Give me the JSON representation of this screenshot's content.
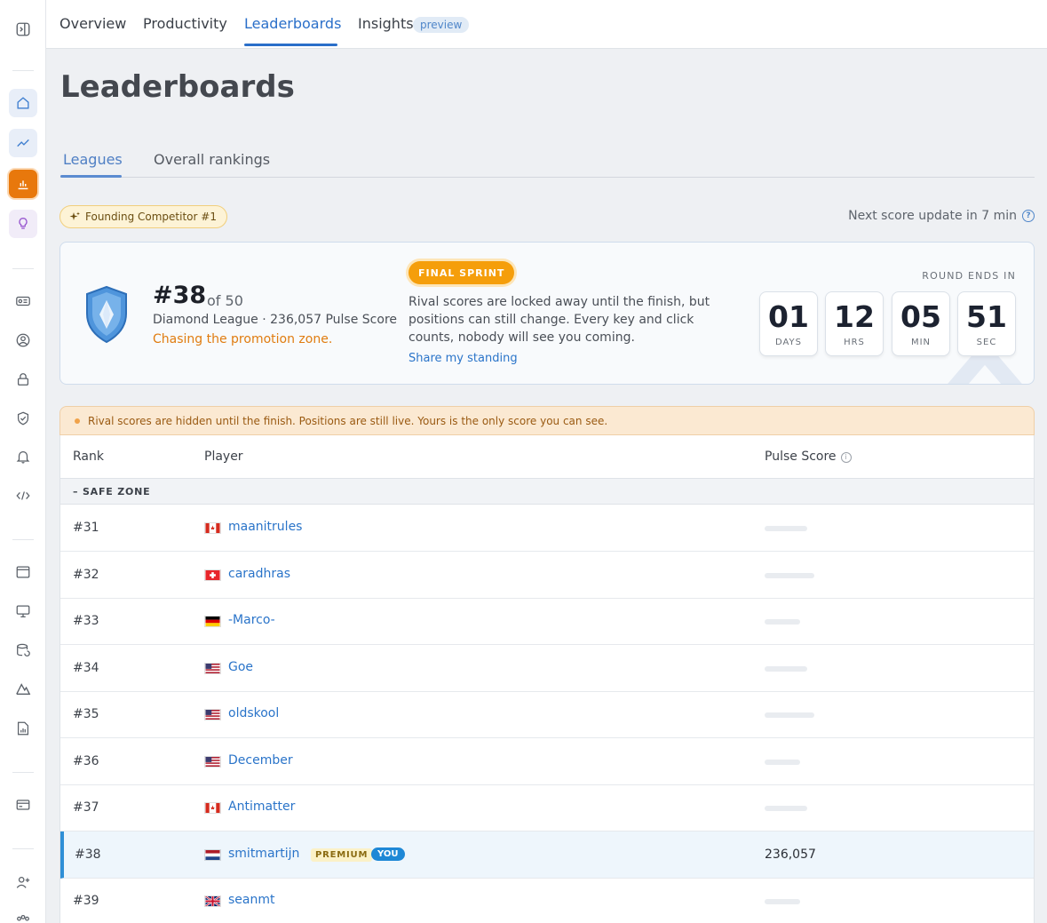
{
  "nav": {
    "tabs": [
      {
        "label": "Overview"
      },
      {
        "label": "Productivity"
      },
      {
        "label": "Leaderboards"
      },
      {
        "label": "Insights"
      }
    ],
    "preview_badge": "preview"
  },
  "page": {
    "title": "Leaderboards",
    "subtabs": [
      {
        "label": "Leagues"
      },
      {
        "label": "Overall rankings"
      }
    ]
  },
  "founding": {
    "label": "Founding Competitor #1"
  },
  "next_update": {
    "label": "Next score update in 7 min"
  },
  "standing": {
    "rank": "#38",
    "of": "of 50",
    "league_line": "Diamond League · 236,057 Pulse Score",
    "status": "Chasing the promotion zone.",
    "badge": "FINAL SPRINT",
    "description": "Rival scores are locked away until the finish, but positions can still change. Every key and click counts, nobody will see you coming.",
    "share": "Share my standing",
    "round_ends_label": "ROUND ENDS IN",
    "countdown": [
      {
        "value": "01",
        "unit": "DAYS"
      },
      {
        "value": "12",
        "unit": "HRS"
      },
      {
        "value": "05",
        "unit": "MIN"
      },
      {
        "value": "51",
        "unit": "SEC"
      }
    ]
  },
  "notice": {
    "text": "Rival scores are hidden until the finish. Positions are still live. Yours is the only score you can see."
  },
  "table": {
    "headers": {
      "rank": "Rank",
      "player": "Player",
      "score": "Pulse Score"
    },
    "zone_label": "SAFE ZONE",
    "rows": [
      {
        "rank": "#31",
        "player": "maanitrules",
        "flag": "canada"
      },
      {
        "rank": "#32",
        "player": "caradhras",
        "flag": "switzerland"
      },
      {
        "rank": "#33",
        "player": "-Marco-",
        "flag": "germany"
      },
      {
        "rank": "#34",
        "player": "Goe",
        "flag": "usa"
      },
      {
        "rank": "#35",
        "player": "oldskool",
        "flag": "usa"
      },
      {
        "rank": "#36",
        "player": "December",
        "flag": "usa"
      },
      {
        "rank": "#37",
        "player": "Antimatter",
        "flag": "canada"
      },
      {
        "rank": "#38",
        "player": "smitmartijn",
        "flag": "netherlands",
        "score": "236,057",
        "premium": "PREMIUM",
        "you": "YOU"
      },
      {
        "rank": "#39",
        "player": "seanmt",
        "flag": "uk"
      }
    ]
  },
  "colors": {
    "accent": "#2a6fc9",
    "active_sidebar": "#e8780c",
    "final_sprint": "#f59e0b"
  }
}
